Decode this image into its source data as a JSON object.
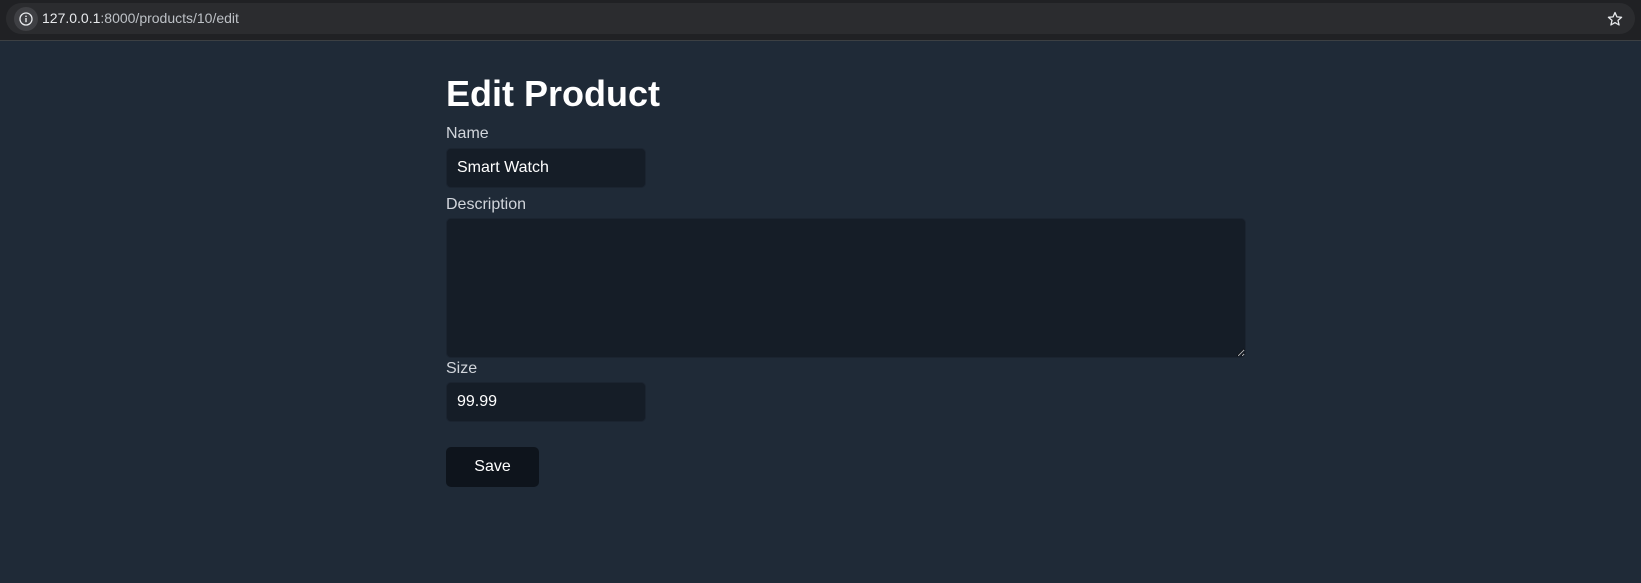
{
  "browser": {
    "url_host": "127.0.0.1",
    "url_path": ":8000/products/10/edit"
  },
  "page": {
    "title": "Edit Product"
  },
  "form": {
    "name_label": "Name",
    "name_value": "Smart Watch",
    "description_label": "Description",
    "description_value": "",
    "size_label": "Size",
    "size_value": "99.99",
    "save_label": "Save"
  },
  "colors": {
    "page_background": "#1f2a37",
    "field_background": "#151d27",
    "button_background": "#0e141c",
    "browser_bar": "#202124"
  },
  "icons": {
    "site_info": "info-icon",
    "bookmark": "star-icon"
  }
}
